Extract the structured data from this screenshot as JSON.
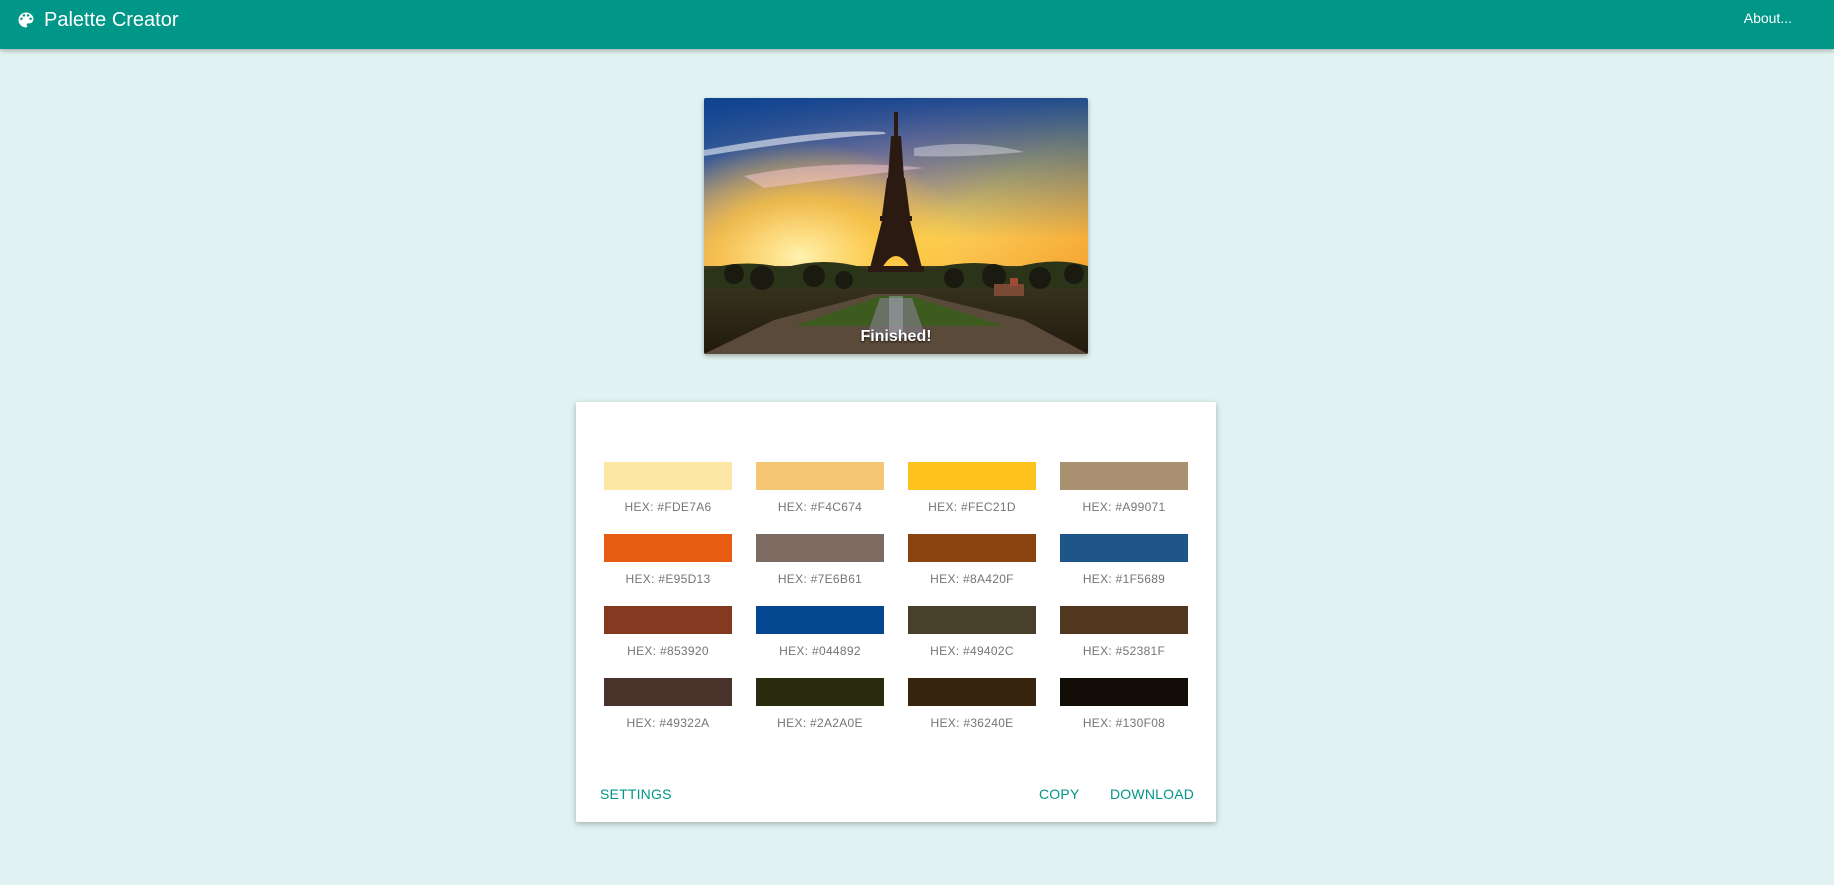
{
  "header": {
    "title": "Palette Creator",
    "icon": "palette-icon",
    "about_label": "About..."
  },
  "image_preview": {
    "status_text": "Finished!"
  },
  "palette": {
    "swatches": [
      {
        "hex": "#FDE7A6",
        "label": "HEX: #FDE7A6"
      },
      {
        "hex": "#F4C674",
        "label": "HEX: #F4C674"
      },
      {
        "hex": "#FEC21D",
        "label": "HEX: #FEC21D"
      },
      {
        "hex": "#A99071",
        "label": "HEX: #A99071"
      },
      {
        "hex": "#E95D13",
        "label": "HEX: #E95D13"
      },
      {
        "hex": "#7E6B61",
        "label": "HEX: #7E6B61"
      },
      {
        "hex": "#8A420F",
        "label": "HEX: #8A420F"
      },
      {
        "hex": "#1F5689",
        "label": "HEX: #1F5689"
      },
      {
        "hex": "#853920",
        "label": "HEX: #853920"
      },
      {
        "hex": "#044892",
        "label": "HEX: #044892"
      },
      {
        "hex": "#49402C",
        "label": "HEX: #49402C"
      },
      {
        "hex": "#52381F",
        "label": "HEX: #52381F"
      },
      {
        "hex": "#49322A",
        "label": "HEX: #49322A"
      },
      {
        "hex": "#2A2A0E",
        "label": "HEX: #2A2A0E"
      },
      {
        "hex": "#36240E",
        "label": "HEX: #36240E"
      },
      {
        "hex": "#130F08",
        "label": "HEX: #130F08"
      }
    ],
    "settings_label": "SETTINGS",
    "copy_label": "COPY",
    "download_label": "DOWNLOAD"
  },
  "colors": {
    "primary": "#009688",
    "background": "#e0f2f1",
    "label_text": "#757575"
  }
}
